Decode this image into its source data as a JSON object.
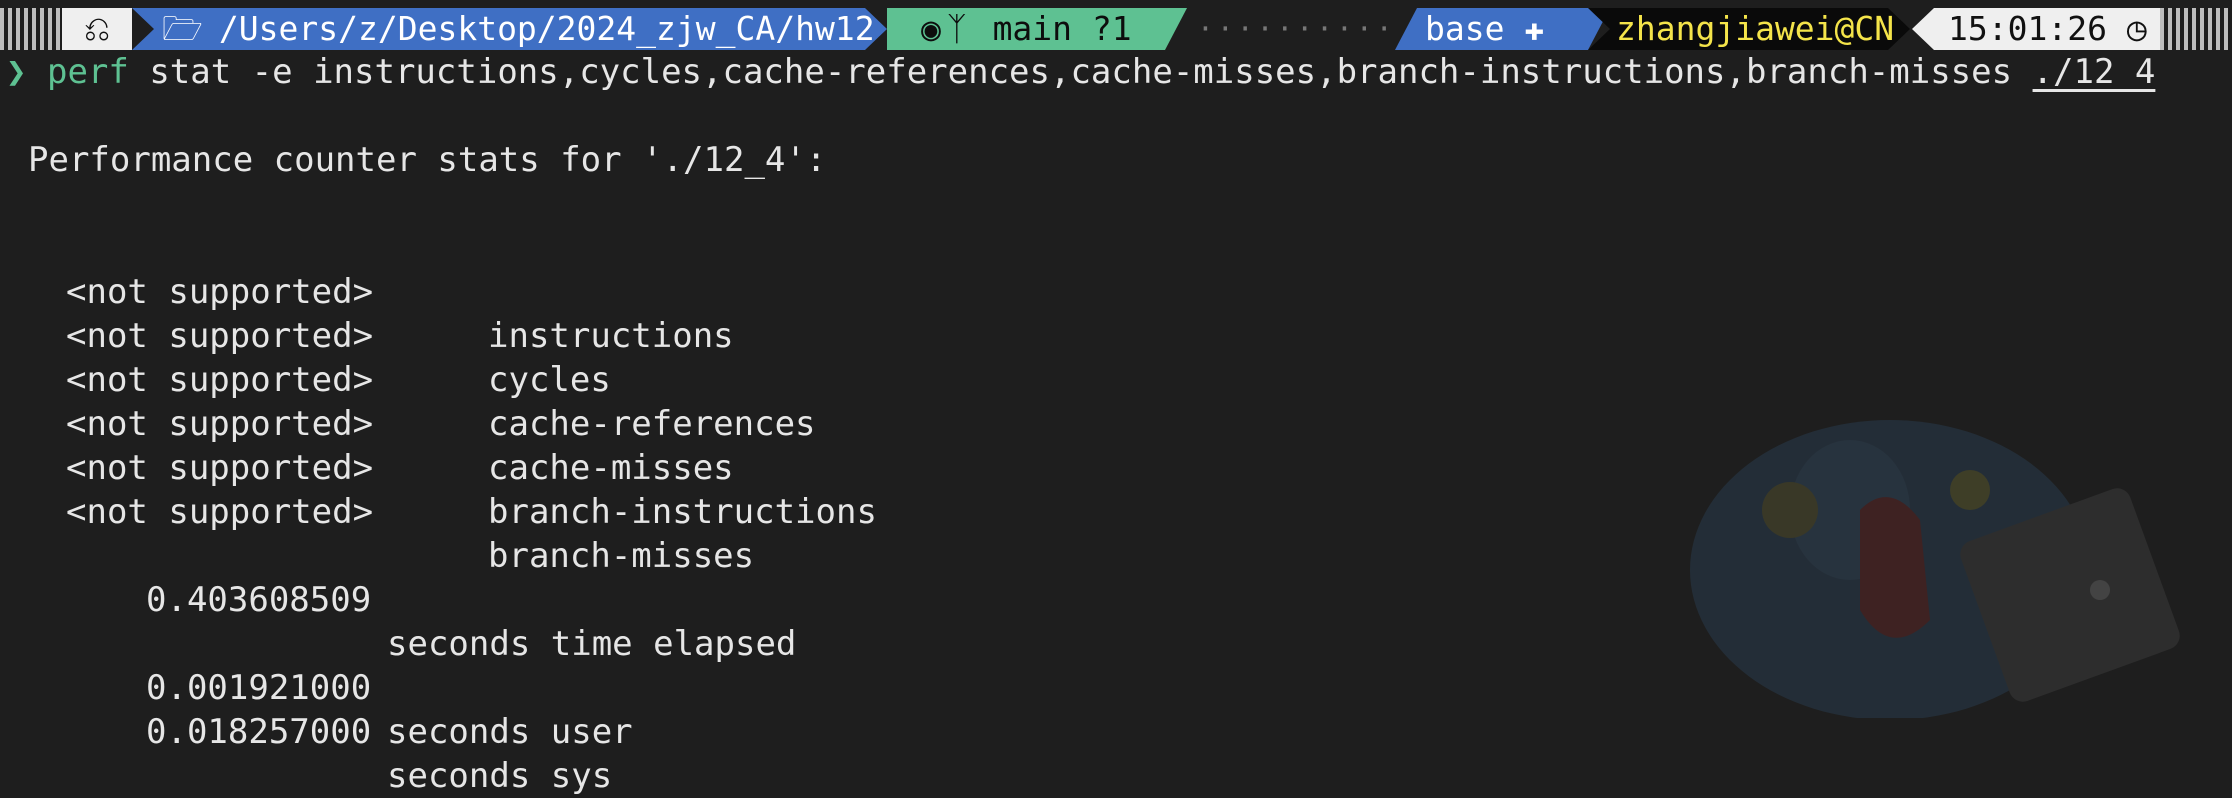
{
  "prompt": {
    "os_icon": "apple-icon",
    "path": "/Users/z/Desktop/2024_zjw_CA/hw12",
    "git_branch": "main",
    "git_status": "?1",
    "dots": "··········",
    "env": "base",
    "user_host": "zhangjiawei@CN",
    "time": "15:01:26",
    "colors": {
      "path_bg": "#3f6fc4",
      "git_bg": "#5ec192",
      "user_fg": "#f4e44a"
    }
  },
  "command": {
    "chevron": "❯",
    "name": "perf",
    "args": " stat -e instructions,cycles,cache-references,cache-misses,branch-instructions,branch-misses ",
    "target": "./12_4"
  },
  "output": {
    "header": "Performance counter stats for './12_4':",
    "counters": [
      {
        "value": "<not supported>",
        "event": "instructions"
      },
      {
        "value": "<not supported>",
        "event": "cycles"
      },
      {
        "value": "<not supported>",
        "event": "cache-references"
      },
      {
        "value": "<not supported>",
        "event": "cache-misses"
      },
      {
        "value": "<not supported>",
        "event": "branch-instructions"
      },
      {
        "value": "<not supported>",
        "event": "branch-misses"
      }
    ],
    "elapsed": {
      "value": "0.403608509",
      "label": "seconds time elapsed"
    },
    "user": {
      "value": "0.001921000",
      "label": "seconds user"
    },
    "sys": {
      "value": "0.018257000",
      "label": "seconds sys"
    }
  }
}
